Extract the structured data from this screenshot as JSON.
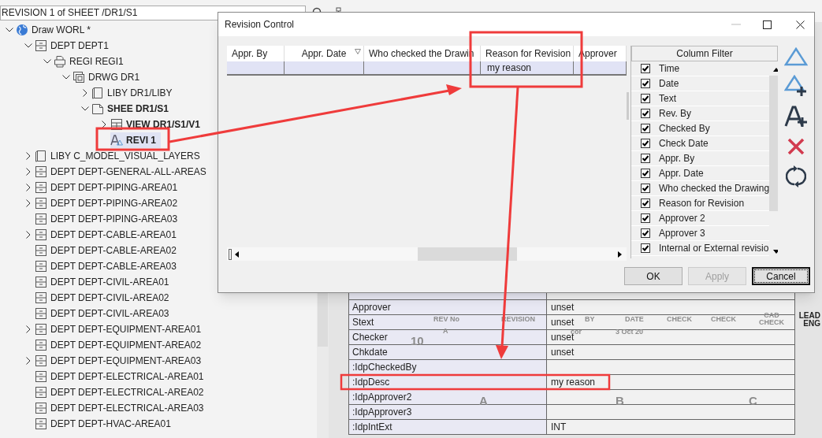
{
  "location_field": {
    "value": "REVISION 1 of SHEET /DR1/S1"
  },
  "tree": [
    {
      "label": "Draw WORL *",
      "kind": "world",
      "expandable": true,
      "expanded": true,
      "bold": false,
      "selected": false,
      "children": [
        {
          "label": "DEPT DEPT1",
          "kind": "dept",
          "expandable": true,
          "expanded": true,
          "bold": false,
          "selected": false,
          "children": [
            {
              "label": "REGI REGI1",
              "kind": "regi",
              "expandable": true,
              "expanded": true,
              "bold": false,
              "selected": false,
              "children": [
                {
                  "label": "DRWG DR1",
                  "kind": "drwg",
                  "expandable": true,
                  "expanded": true,
                  "bold": false,
                  "selected": false,
                  "children": [
                    {
                      "label": "LIBY DR1/LIBY",
                      "kind": "liby",
                      "expandable": true,
                      "expanded": false,
                      "bold": false,
                      "selected": false
                    },
                    {
                      "label": "SHEE DR1/S1",
                      "kind": "shee",
                      "expandable": true,
                      "expanded": true,
                      "bold": true,
                      "selected": false,
                      "children": [
                        {
                          "label": "VIEW DR1/S1/V1",
                          "kind": "view",
                          "expandable": true,
                          "expanded": false,
                          "bold": true,
                          "selected": false
                        },
                        {
                          "label": "REVI 1",
                          "kind": "revi",
                          "expandable": false,
                          "bold": true,
                          "selected": true
                        }
                      ]
                    }
                  ]
                }
              ]
            }
          ]
        },
        {
          "label": "LIBY C_MODEL_VISUAL_LAYERS",
          "kind": "liby",
          "expandable": true,
          "expanded": false,
          "bold": false,
          "selected": false
        },
        {
          "label": "DEPT DEPT-GENERAL-ALL-AREAS",
          "kind": "dept",
          "expandable": true,
          "expanded": false,
          "bold": false,
          "selected": false
        },
        {
          "label": "DEPT DEPT-PIPING-AREA01",
          "kind": "dept",
          "expandable": true,
          "expanded": false,
          "bold": false,
          "selected": false
        },
        {
          "label": "DEPT DEPT-PIPING-AREA02",
          "kind": "dept",
          "expandable": true,
          "expanded": false,
          "bold": false,
          "selected": false
        },
        {
          "label": "DEPT DEPT-PIPING-AREA03",
          "kind": "dept",
          "expandable": false,
          "bold": false,
          "selected": false
        },
        {
          "label": "DEPT DEPT-CABLE-AREA01",
          "kind": "dept",
          "expandable": true,
          "expanded": false,
          "bold": false,
          "selected": false
        },
        {
          "label": "DEPT DEPT-CABLE-AREA02",
          "kind": "dept",
          "expandable": false,
          "bold": false,
          "selected": false
        },
        {
          "label": "DEPT DEPT-CABLE-AREA03",
          "kind": "dept",
          "expandable": false,
          "bold": false,
          "selected": false
        },
        {
          "label": "DEPT DEPT-CIVIL-AREA01",
          "kind": "dept",
          "expandable": false,
          "bold": false,
          "selected": false
        },
        {
          "label": "DEPT DEPT-CIVIL-AREA02",
          "kind": "dept",
          "expandable": false,
          "bold": false,
          "selected": false
        },
        {
          "label": "DEPT DEPT-CIVIL-AREA03",
          "kind": "dept",
          "expandable": false,
          "bold": false,
          "selected": false
        },
        {
          "label": "DEPT DEPT-EQUIPMENT-AREA01",
          "kind": "dept",
          "expandable": true,
          "expanded": false,
          "bold": false,
          "selected": false
        },
        {
          "label": "DEPT DEPT-EQUIPMENT-AREA02",
          "kind": "dept",
          "expandable": false,
          "bold": false,
          "selected": false
        },
        {
          "label": "DEPT DEPT-EQUIPMENT-AREA03",
          "kind": "dept",
          "expandable": true,
          "expanded": false,
          "bold": false,
          "selected": false
        },
        {
          "label": "DEPT DEPT-ELECTRICAL-AREA01",
          "kind": "dept",
          "expandable": false,
          "bold": false,
          "selected": false
        },
        {
          "label": "DEPT DEPT-ELECTRICAL-AREA02",
          "kind": "dept",
          "expandable": false,
          "bold": false,
          "selected": false
        },
        {
          "label": "DEPT DEPT-ELECTRICAL-AREA03",
          "kind": "dept",
          "expandable": false,
          "bold": false,
          "selected": false
        },
        {
          "label": "DEPT DEPT-HVAC-AREA01",
          "kind": "dept",
          "expandable": false,
          "bold": false,
          "selected": false
        }
      ]
    }
  ],
  "properties": [
    {
      "name": "Approver",
      "value": "unset"
    },
    {
      "name": "Stext",
      "value": "unset"
    },
    {
      "name": "Checker",
      "value": "unset"
    },
    {
      "name": "Chkdate",
      "value": "unset"
    },
    {
      "name": ":IdpCheckedBy"
    },
    {
      "name": ":IdpDesc",
      "value": "my reason"
    },
    {
      "name": ":IdpApprover2"
    },
    {
      "name": ":IdpApprover3"
    },
    {
      "name": ":IdpIntExt",
      "value": "INT"
    }
  ],
  "title_block": [
    "REV No",
    "REVISION",
    "BY",
    "DATE",
    "CHECK",
    "CHECK",
    "CAD CHECK",
    "A",
    "cor",
    "3 Oct 20",
    "10",
    "A",
    "B",
    "C"
  ],
  "drawing_label": [
    "LEAD",
    "ENG"
  ],
  "dialog": {
    "title": "Revision Control",
    "grid": {
      "columns": [
        {
          "label": "Appr. By",
          "filtered": false
        },
        {
          "label": "Appr. Date",
          "filtered": true
        },
        {
          "label": "Who checked the Drawin",
          "filtered": false
        },
        {
          "label": "Reason for Revision",
          "filtered": false
        },
        {
          "label": "Approver",
          "filtered": false
        }
      ],
      "rows": [
        {
          "selected": true,
          "cells": [
            null,
            null,
            null,
            "my reason",
            null
          ]
        }
      ]
    },
    "column_filter": {
      "title": "Column Filter",
      "items": [
        {
          "label": "Time",
          "checked": true
        },
        {
          "label": "Date",
          "checked": true
        },
        {
          "label": "Text",
          "checked": true
        },
        {
          "label": "Rev. By",
          "checked": true
        },
        {
          "label": "Checked By",
          "checked": true
        },
        {
          "label": "Check Date",
          "checked": true
        },
        {
          "label": "Appr. By",
          "checked": true
        },
        {
          "label": "Appr. Date",
          "checked": true
        },
        {
          "label": "Who checked the Drawing",
          "checked": true
        },
        {
          "label": "Reason for Revision",
          "checked": true
        },
        {
          "label": "Approver 2",
          "checked": true
        },
        {
          "label": "Approver 3",
          "checked": true
        },
        {
          "label": "Internal or External revisio",
          "checked": true
        }
      ]
    },
    "buttons": [
      {
        "label": "OK",
        "disabled": false,
        "default": false
      },
      {
        "label": "Apply",
        "disabled": true,
        "default": false
      },
      {
        "label": "Cancel",
        "disabled": false,
        "default": true
      }
    ]
  }
}
